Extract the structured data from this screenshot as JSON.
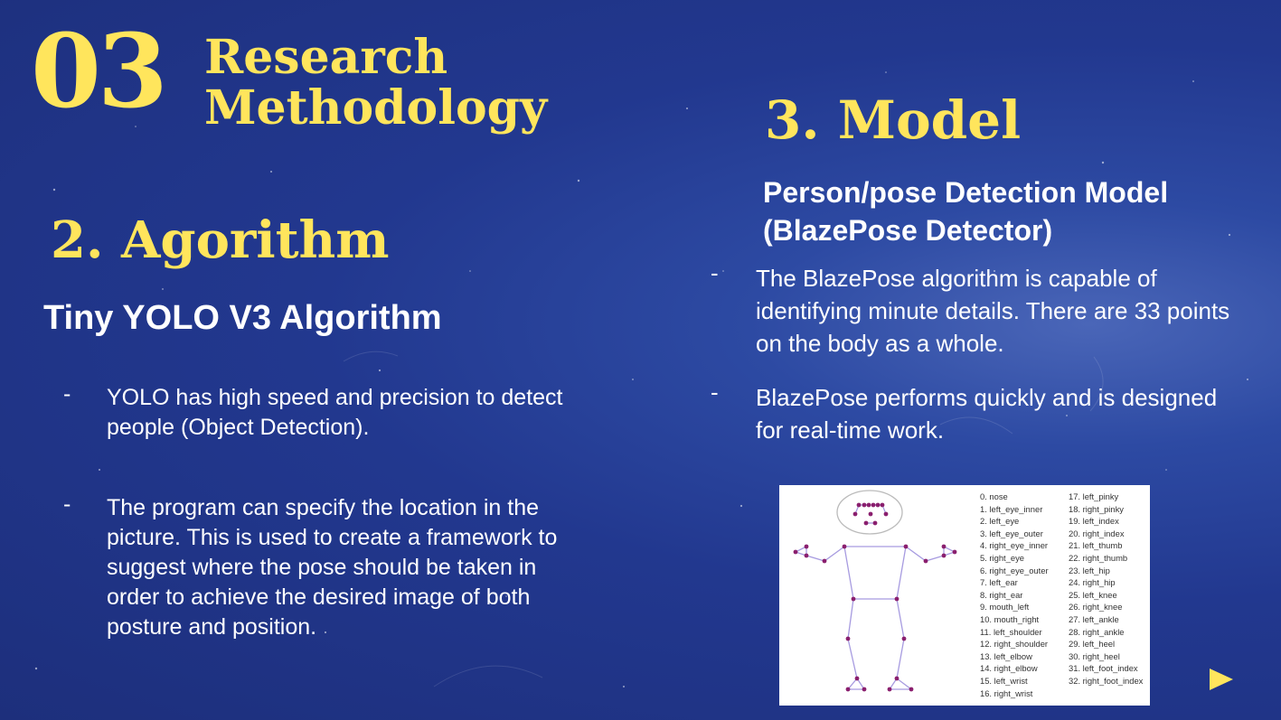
{
  "section": {
    "number": "03",
    "title_line1": "Research",
    "title_line2": "Methodology"
  },
  "algorithm": {
    "heading": "2. Agorithm",
    "subheading": "Tiny YOLO V3 Algorithm",
    "bullets": [
      {
        "dash": "-",
        "text": "YOLO has high speed and precision to detect people (Object Detection)."
      },
      {
        "dash": "-",
        "text": "The program can specify the location in the picture. This is used to create a framework to suggest where the pose should be taken in order to achieve the desired image of both posture and position."
      }
    ]
  },
  "model": {
    "heading": "3. Model",
    "subheading_line1": "Person/pose Detection Model",
    "subheading_line2": "(BlazePose Detector)",
    "bullets": [
      {
        "dash": "-",
        "text": "The BlazePose algorithm is capable of identifying minute details. There are 33 points on the body as a whole."
      },
      {
        "dash": "-",
        "text": "BlazePose performs quickly and is designed for real-time work."
      }
    ]
  },
  "figure": {
    "joint_color": "#8a1f6e",
    "bone_color": "#a79be0",
    "keypoints_col1": [
      "0. nose",
      "1. left_eye_inner",
      "2. left_eye",
      "3. left_eye_outer",
      "4. right_eye_inner",
      "5. right_eye",
      "6. right_eye_outer",
      "7. left_ear",
      "8. right_ear",
      "9. mouth_left",
      "10. mouth_right",
      "11. left_shoulder",
      "12. right_shoulder",
      "13. left_elbow",
      "14. right_elbow",
      "15. left_wrist",
      "16. right_wrist"
    ],
    "keypoints_col2": [
      "17. left_pinky",
      "18. right_pinky",
      "19. left_index",
      "20. right_index",
      "21. left_thumb",
      "22. right_thumb",
      "23. left_hip",
      "24. right_hip",
      "25. left_knee",
      "26. right_knee",
      "27. left_ankle",
      "28. right_ankle",
      "29. left_heel",
      "30. right_heel",
      "31. left_foot_index",
      "32. right_foot_index"
    ]
  },
  "nav": {
    "next_icon": "play-triangle-icon",
    "accent": "#ffe55c"
  }
}
